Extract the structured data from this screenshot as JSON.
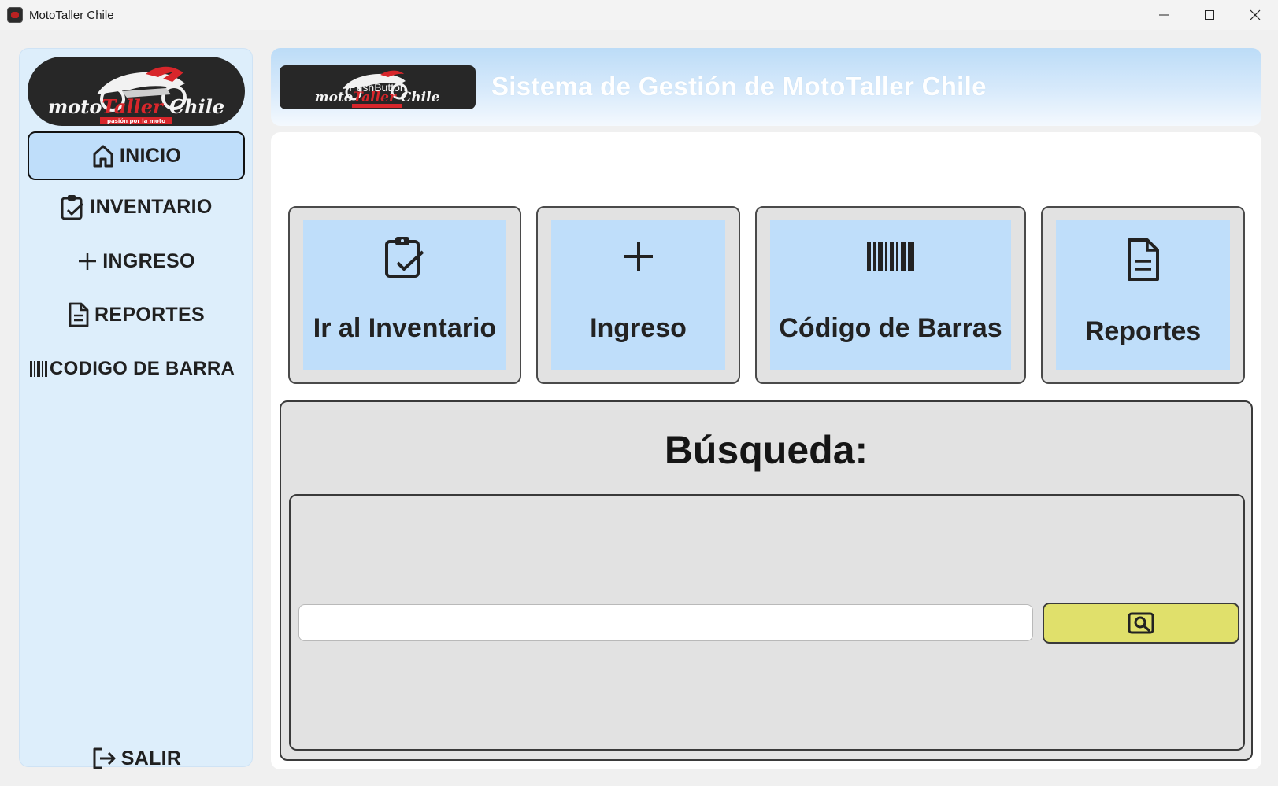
{
  "window": {
    "title": "MotoTaller Chile",
    "controls": [
      "minimize-icon",
      "maximize-icon",
      "close-icon"
    ]
  },
  "sidebar": {
    "logo": {
      "text_main": "motoTaller Chile",
      "tagline": "pasión por la moto"
    },
    "items": [
      {
        "label": "INICIO",
        "icon": "home-icon",
        "active": true
      },
      {
        "label": "INVENTARIO",
        "icon": "clipboard-check-icon",
        "active": false
      },
      {
        "label": "INGRESO",
        "icon": "plus-icon",
        "active": false
      },
      {
        "label": "REPORTES",
        "icon": "document-icon",
        "active": false
      },
      {
        "label": "CODIGO DE BARRA",
        "icon": "barcode-icon",
        "active": false
      }
    ],
    "exit": {
      "label": "SALIR",
      "icon": "logout-icon"
    }
  },
  "header": {
    "logo_button_label": "PushButton",
    "title": "Sistema de Gestión de MotoTaller Chile"
  },
  "cards": [
    {
      "label": "Ir al Inventario",
      "icon": "clipboard-check-icon"
    },
    {
      "label": "Ingreso",
      "icon": "plus-icon"
    },
    {
      "label": "Código de Barras",
      "icon": "barcode-icon"
    },
    {
      "label": "Reportes",
      "icon": "document-icon"
    }
  ],
  "search": {
    "title": "Búsqueda:",
    "input_value": "",
    "input_placeholder": "",
    "button_icon": "search-icon"
  },
  "colors": {
    "sidebar_bg": "#ddeefb",
    "active_nav_bg": "#bfdefa",
    "card_inner_bg": "#bfdefa",
    "search_button_bg": "#e0e06b",
    "panel_bg": "#e2e2e2",
    "logo_red": "#d8262b"
  }
}
